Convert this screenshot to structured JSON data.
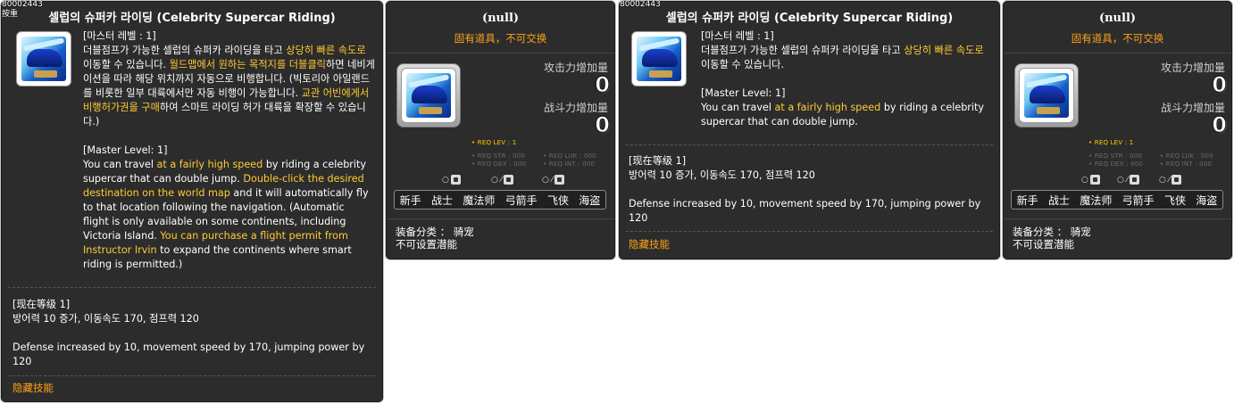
{
  "skill": {
    "id": "80002443",
    "id_sub": "按重",
    "title": "셀럽의 슈퍼카 라이딩 (Celebrity Supercar Riding)",
    "kr": {
      "master_level": "[마스터 레벨 : 1]",
      "desc_a": "더블점프가 가능한 셀럽의 슈퍼카 라이딩을 타고 ",
      "desc_hl1": "상당히 빠른 속도로",
      "desc_b": " 이동할 수 있습니다. ",
      "desc_hl2": "월드맵에서 원하는 목적지를 더블클릭",
      "desc_c": "하면 네비게이션을 따라 해당 위치까지 자동으로 비행합니다. (빅토리아 아일랜드를 비롯한 일부 대륙에서만 자동 비행이 가능합니다. ",
      "desc_hl3": "교관 어빈에게서 비행허가권을 구매",
      "desc_d": "하여 스마트 라이딩 허가 대륙을 확장할 수 있습니다.)"
    },
    "kr_short": {
      "desc_a": "더블점프가 가능한 셀럽의 슈퍼카 라이딩을 타고 ",
      "desc_hl1": "상당히 빠른 속도로",
      "desc_b": " 이동할 수 있습니다."
    },
    "en": {
      "master_level": "[Master Level: 1]",
      "desc_a": "You can travel ",
      "desc_hl1": "at a fairly high speed",
      "desc_b": " by riding a celebrity supercar that can double jump. ",
      "desc_hl2": "Double-click the desired destination on the world map",
      "desc_c": " and it will automatically fly to that location following the navigation. (Automatic flight is only available on some continents, including Victoria Island. ",
      "desc_hl3": "You can purchase a flight permit from Instructor Irvin",
      "desc_d": " to expand the continents where smart riding is permitted.)"
    },
    "en_short": {
      "desc_a": "You can travel ",
      "desc_hl1": "at a fairly high speed",
      "desc_b": " by riding a celebrity supercar that can double jump."
    },
    "current_level": "[现在等级 1]",
    "effect_kr": "방어력 10 증가, 이동속도 170, 점프력 120",
    "effect_en": "Defense increased by 10, movement speed by 170, jumping power by 120",
    "hidden_label": "隐藏技能"
  },
  "item": {
    "title": "(null)",
    "untradeable": "固有道具，不可交换",
    "attack_label": "攻击力增加量",
    "attack_value": "0",
    "combat_label": "战斗力增加量",
    "combat_value": "0",
    "req_lev": "• REQ LEV :    1",
    "req_str": "• REQ STR : 000",
    "req_dex": "• REQ DEX : 000",
    "req_luk": "• REQ LUK : 000",
    "req_int": "• REQ INT : 000",
    "mini": [
      "○",
      "○ ⁄",
      "○ ⁄"
    ],
    "jobs": [
      "新手",
      "战士",
      "魔法师",
      "弓箭手",
      "飞侠",
      "海盗"
    ],
    "category": "装备分类 ： 骑宠",
    "no_potential": "不可设置潜能"
  },
  "colors": {
    "panel_bg": "#2c2c2c",
    "highlight": "#ffcc33",
    "orange": "#ffa21a"
  }
}
